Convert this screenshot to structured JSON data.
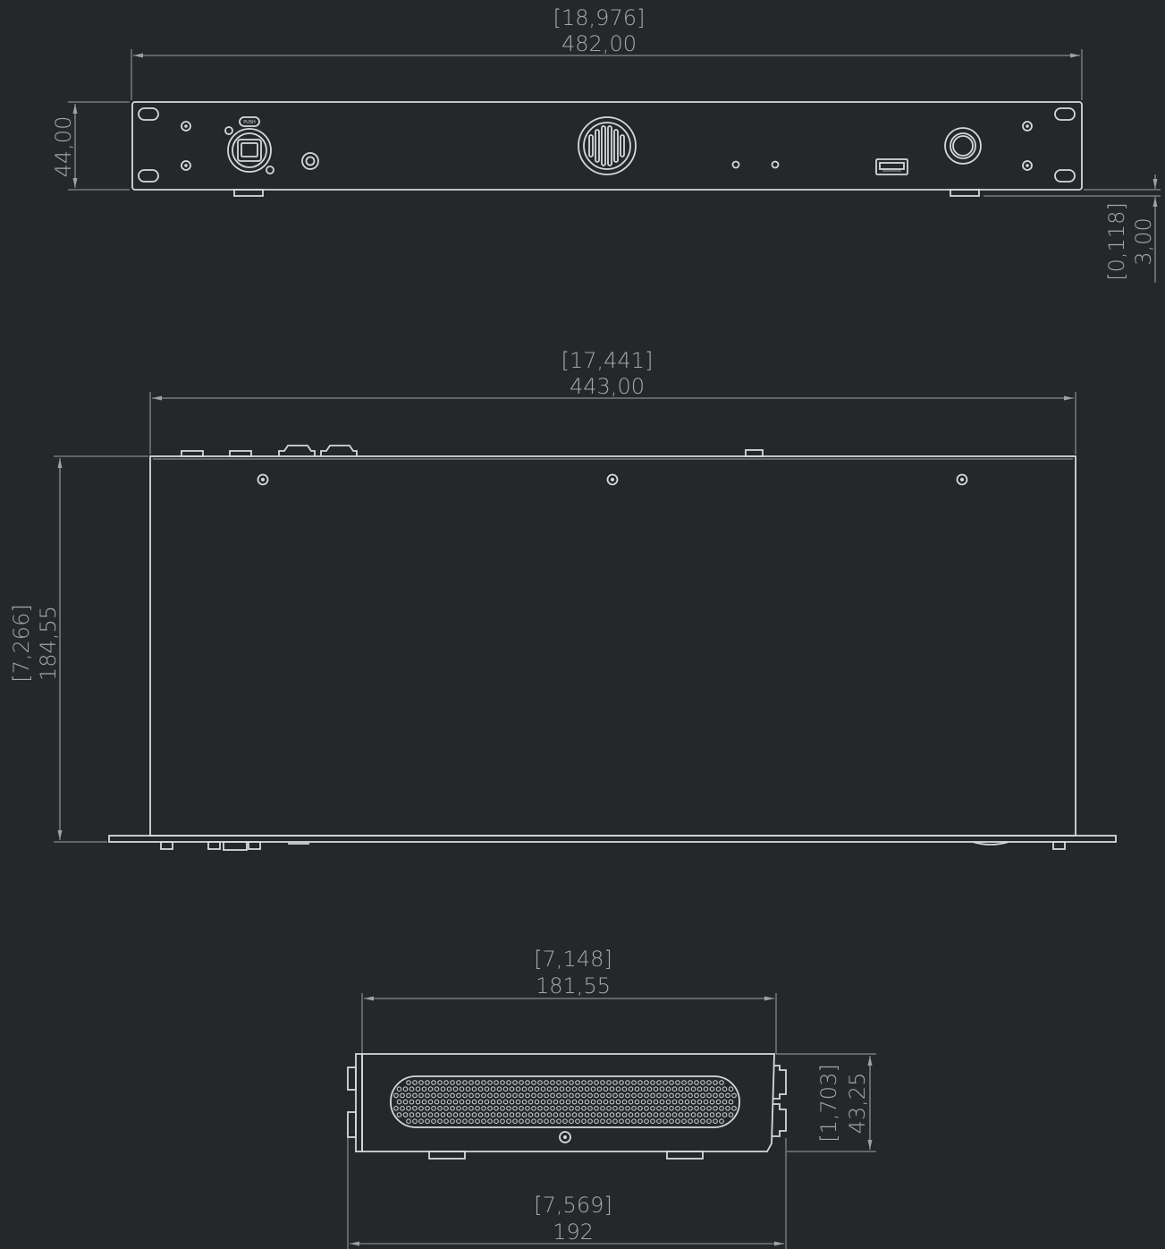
{
  "dimensions": {
    "front_width": {
      "inch": "[18,976]",
      "mm": "482,00"
    },
    "front_height": {
      "mm": "44,00"
    },
    "foot_height": {
      "inch": "[0,118]",
      "mm": "3,00"
    },
    "top_width": {
      "inch": "[17,441]",
      "mm": "443,00"
    },
    "top_depth": {
      "inch": "[7,266]",
      "mm": "184,55"
    },
    "side_body_depth": {
      "inch": "[7,148]",
      "mm": "181,55"
    },
    "side_height": {
      "inch": "[1,703]",
      "mm": "43,25"
    },
    "side_total_depth": {
      "inch": "[7,569]",
      "mm": "192"
    }
  },
  "front_panel": {
    "ethercon_label": "PUSH"
  },
  "colors": {
    "background": "#25282b",
    "line": "#d6d8da",
    "dimension": "#9ea2a6"
  }
}
